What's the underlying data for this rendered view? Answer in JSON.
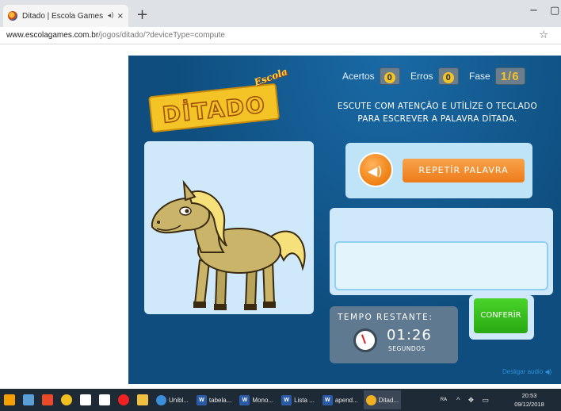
{
  "browser": {
    "tab_title": "Ditado | Escola Games - Jogo",
    "tab_audio_icon": "speaker-icon",
    "tab_close": "×",
    "new_tab": "+",
    "minimize": "−",
    "maximize": "▢",
    "url_host": "www.escolagames.com.br",
    "url_path": "/jogos/ditado/?deviceType=compute",
    "bookmark": "☆"
  },
  "game": {
    "logo_title": "DİTADO",
    "logo_escola": "Escola",
    "score": {
      "acertos_label": "Acertos",
      "acertos_value": "0",
      "erros_label": "Erros",
      "erros_value": "0",
      "fase_label": "Fase",
      "fase_value": "1/6"
    },
    "instructions": "ESCUTE COM ATENÇÃO E UTİLİZE O TECLADO PARA ESCREVER A PALAVRA DİTADA.",
    "repeat_label": "REPETİR PALAVRA",
    "answer_value": "",
    "timer_label": "TEMPO RESTANTE:",
    "timer_value": "01:26",
    "timer_unit": "SEGUNDOS",
    "confirm_label": "CONFERİR",
    "mute_label": "Desligar audio",
    "colors": {
      "background": "#0e4d7d",
      "panel": "#cfe9fa",
      "orange": "#f28a1f",
      "green": "#2aa913",
      "yellow": "#f4c326"
    }
  },
  "taskbar": {
    "apps": [
      {
        "label": "Unibl...",
        "icon": "app-icon"
      },
      {
        "label": "tabela...",
        "icon": "word-icon"
      },
      {
        "label": "Mono...",
        "icon": "word-icon"
      },
      {
        "label": "Lista ...",
        "icon": "word-icon"
      },
      {
        "label": "apend...",
        "icon": "word-icon"
      },
      {
        "label": "Ditad...",
        "icon": "chrome-icon"
      }
    ],
    "time": "20:53",
    "date": "09/12/2018"
  }
}
